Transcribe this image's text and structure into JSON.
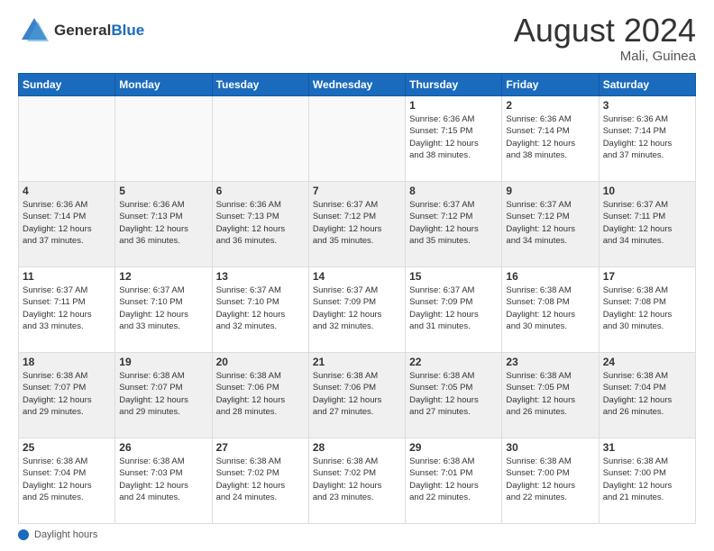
{
  "header": {
    "logo_line1": "General",
    "logo_line2": "Blue",
    "month_title": "August 2024",
    "subtitle": "Mali, Guinea"
  },
  "footer": {
    "daylight_label": "Daylight hours"
  },
  "days_of_week": [
    "Sunday",
    "Monday",
    "Tuesday",
    "Wednesday",
    "Thursday",
    "Friday",
    "Saturday"
  ],
  "weeks": [
    {
      "days": [
        {
          "number": "",
          "info": "",
          "empty": true
        },
        {
          "number": "",
          "info": "",
          "empty": true
        },
        {
          "number": "",
          "info": "",
          "empty": true
        },
        {
          "number": "",
          "info": "",
          "empty": true
        },
        {
          "number": "1",
          "info": "Sunrise: 6:36 AM\nSunset: 7:15 PM\nDaylight: 12 hours\nand 38 minutes."
        },
        {
          "number": "2",
          "info": "Sunrise: 6:36 AM\nSunset: 7:14 PM\nDaylight: 12 hours\nand 38 minutes."
        },
        {
          "number": "3",
          "info": "Sunrise: 6:36 AM\nSunset: 7:14 PM\nDaylight: 12 hours\nand 37 minutes."
        }
      ]
    },
    {
      "shaded": true,
      "days": [
        {
          "number": "4",
          "info": "Sunrise: 6:36 AM\nSunset: 7:14 PM\nDaylight: 12 hours\nand 37 minutes."
        },
        {
          "number": "5",
          "info": "Sunrise: 6:36 AM\nSunset: 7:13 PM\nDaylight: 12 hours\nand 36 minutes."
        },
        {
          "number": "6",
          "info": "Sunrise: 6:36 AM\nSunset: 7:13 PM\nDaylight: 12 hours\nand 36 minutes."
        },
        {
          "number": "7",
          "info": "Sunrise: 6:37 AM\nSunset: 7:12 PM\nDaylight: 12 hours\nand 35 minutes."
        },
        {
          "number": "8",
          "info": "Sunrise: 6:37 AM\nSunset: 7:12 PM\nDaylight: 12 hours\nand 35 minutes."
        },
        {
          "number": "9",
          "info": "Sunrise: 6:37 AM\nSunset: 7:12 PM\nDaylight: 12 hours\nand 34 minutes."
        },
        {
          "number": "10",
          "info": "Sunrise: 6:37 AM\nSunset: 7:11 PM\nDaylight: 12 hours\nand 34 minutes."
        }
      ]
    },
    {
      "days": [
        {
          "number": "11",
          "info": "Sunrise: 6:37 AM\nSunset: 7:11 PM\nDaylight: 12 hours\nand 33 minutes."
        },
        {
          "number": "12",
          "info": "Sunrise: 6:37 AM\nSunset: 7:10 PM\nDaylight: 12 hours\nand 33 minutes."
        },
        {
          "number": "13",
          "info": "Sunrise: 6:37 AM\nSunset: 7:10 PM\nDaylight: 12 hours\nand 32 minutes."
        },
        {
          "number": "14",
          "info": "Sunrise: 6:37 AM\nSunset: 7:09 PM\nDaylight: 12 hours\nand 32 minutes."
        },
        {
          "number": "15",
          "info": "Sunrise: 6:37 AM\nSunset: 7:09 PM\nDaylight: 12 hours\nand 31 minutes."
        },
        {
          "number": "16",
          "info": "Sunrise: 6:38 AM\nSunset: 7:08 PM\nDaylight: 12 hours\nand 30 minutes."
        },
        {
          "number": "17",
          "info": "Sunrise: 6:38 AM\nSunset: 7:08 PM\nDaylight: 12 hours\nand 30 minutes."
        }
      ]
    },
    {
      "shaded": true,
      "days": [
        {
          "number": "18",
          "info": "Sunrise: 6:38 AM\nSunset: 7:07 PM\nDaylight: 12 hours\nand 29 minutes."
        },
        {
          "number": "19",
          "info": "Sunrise: 6:38 AM\nSunset: 7:07 PM\nDaylight: 12 hours\nand 29 minutes."
        },
        {
          "number": "20",
          "info": "Sunrise: 6:38 AM\nSunset: 7:06 PM\nDaylight: 12 hours\nand 28 minutes."
        },
        {
          "number": "21",
          "info": "Sunrise: 6:38 AM\nSunset: 7:06 PM\nDaylight: 12 hours\nand 27 minutes."
        },
        {
          "number": "22",
          "info": "Sunrise: 6:38 AM\nSunset: 7:05 PM\nDaylight: 12 hours\nand 27 minutes."
        },
        {
          "number": "23",
          "info": "Sunrise: 6:38 AM\nSunset: 7:05 PM\nDaylight: 12 hours\nand 26 minutes."
        },
        {
          "number": "24",
          "info": "Sunrise: 6:38 AM\nSunset: 7:04 PM\nDaylight: 12 hours\nand 26 minutes."
        }
      ]
    },
    {
      "days": [
        {
          "number": "25",
          "info": "Sunrise: 6:38 AM\nSunset: 7:04 PM\nDaylight: 12 hours\nand 25 minutes."
        },
        {
          "number": "26",
          "info": "Sunrise: 6:38 AM\nSunset: 7:03 PM\nDaylight: 12 hours\nand 24 minutes."
        },
        {
          "number": "27",
          "info": "Sunrise: 6:38 AM\nSunset: 7:02 PM\nDaylight: 12 hours\nand 24 minutes."
        },
        {
          "number": "28",
          "info": "Sunrise: 6:38 AM\nSunset: 7:02 PM\nDaylight: 12 hours\nand 23 minutes."
        },
        {
          "number": "29",
          "info": "Sunrise: 6:38 AM\nSunset: 7:01 PM\nDaylight: 12 hours\nand 22 minutes."
        },
        {
          "number": "30",
          "info": "Sunrise: 6:38 AM\nSunset: 7:00 PM\nDaylight: 12 hours\nand 22 minutes."
        },
        {
          "number": "31",
          "info": "Sunrise: 6:38 AM\nSunset: 7:00 PM\nDaylight: 12 hours\nand 21 minutes."
        }
      ]
    }
  ]
}
